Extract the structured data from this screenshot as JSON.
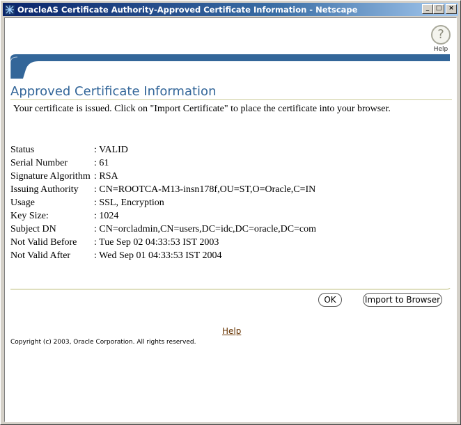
{
  "window": {
    "title": "OracleAS Certificate Authority-Approved Certificate Information - Netscape",
    "buttons": {
      "minimize": "_",
      "maximize": "□",
      "close": "×"
    }
  },
  "header": {
    "help_icon": "?",
    "help_label": "Help"
  },
  "page": {
    "title": "Approved Certificate Information",
    "intro": "Your certificate is issued. Click on \"Import Certificate\" to place the certificate into your browser."
  },
  "details": [
    {
      "label": "Status",
      "value": ": VALID"
    },
    {
      "label": "Serial Number",
      "value": ": 61"
    },
    {
      "label": "Signature Algorithm",
      "value": ": RSA"
    },
    {
      "label": "Issuing Authority",
      "value": ": CN=ROOTCA-M13-insn178f,OU=ST,O=Oracle,C=IN"
    },
    {
      "label": "Usage",
      "value": ": SSL, Encryption"
    },
    {
      "label": "Key Size:",
      "value": ": 1024"
    },
    {
      "label": "Subject DN",
      "value": ": CN=orcladmin,CN=users,DC=idc,DC=oracle,DC=com"
    },
    {
      "label": "Not Valid Before",
      "value": ": Tue Sep 02 04:33:53 IST 2003"
    },
    {
      "label": "Not Valid After",
      "value": ": Wed Sep 01 04:33:53 IST 2004"
    }
  ],
  "actions": {
    "ok_label": "OK",
    "import_label": "Import to Browser"
  },
  "footer": {
    "help_link": "Help",
    "copyright": "Copyright (c) 2003, Oracle Corporation. All rights reserved."
  },
  "colors": {
    "title_bar": "#0a246a",
    "banner": "#336699",
    "page_title": "#336699",
    "rule": "#cccc99",
    "link": "#663300"
  }
}
